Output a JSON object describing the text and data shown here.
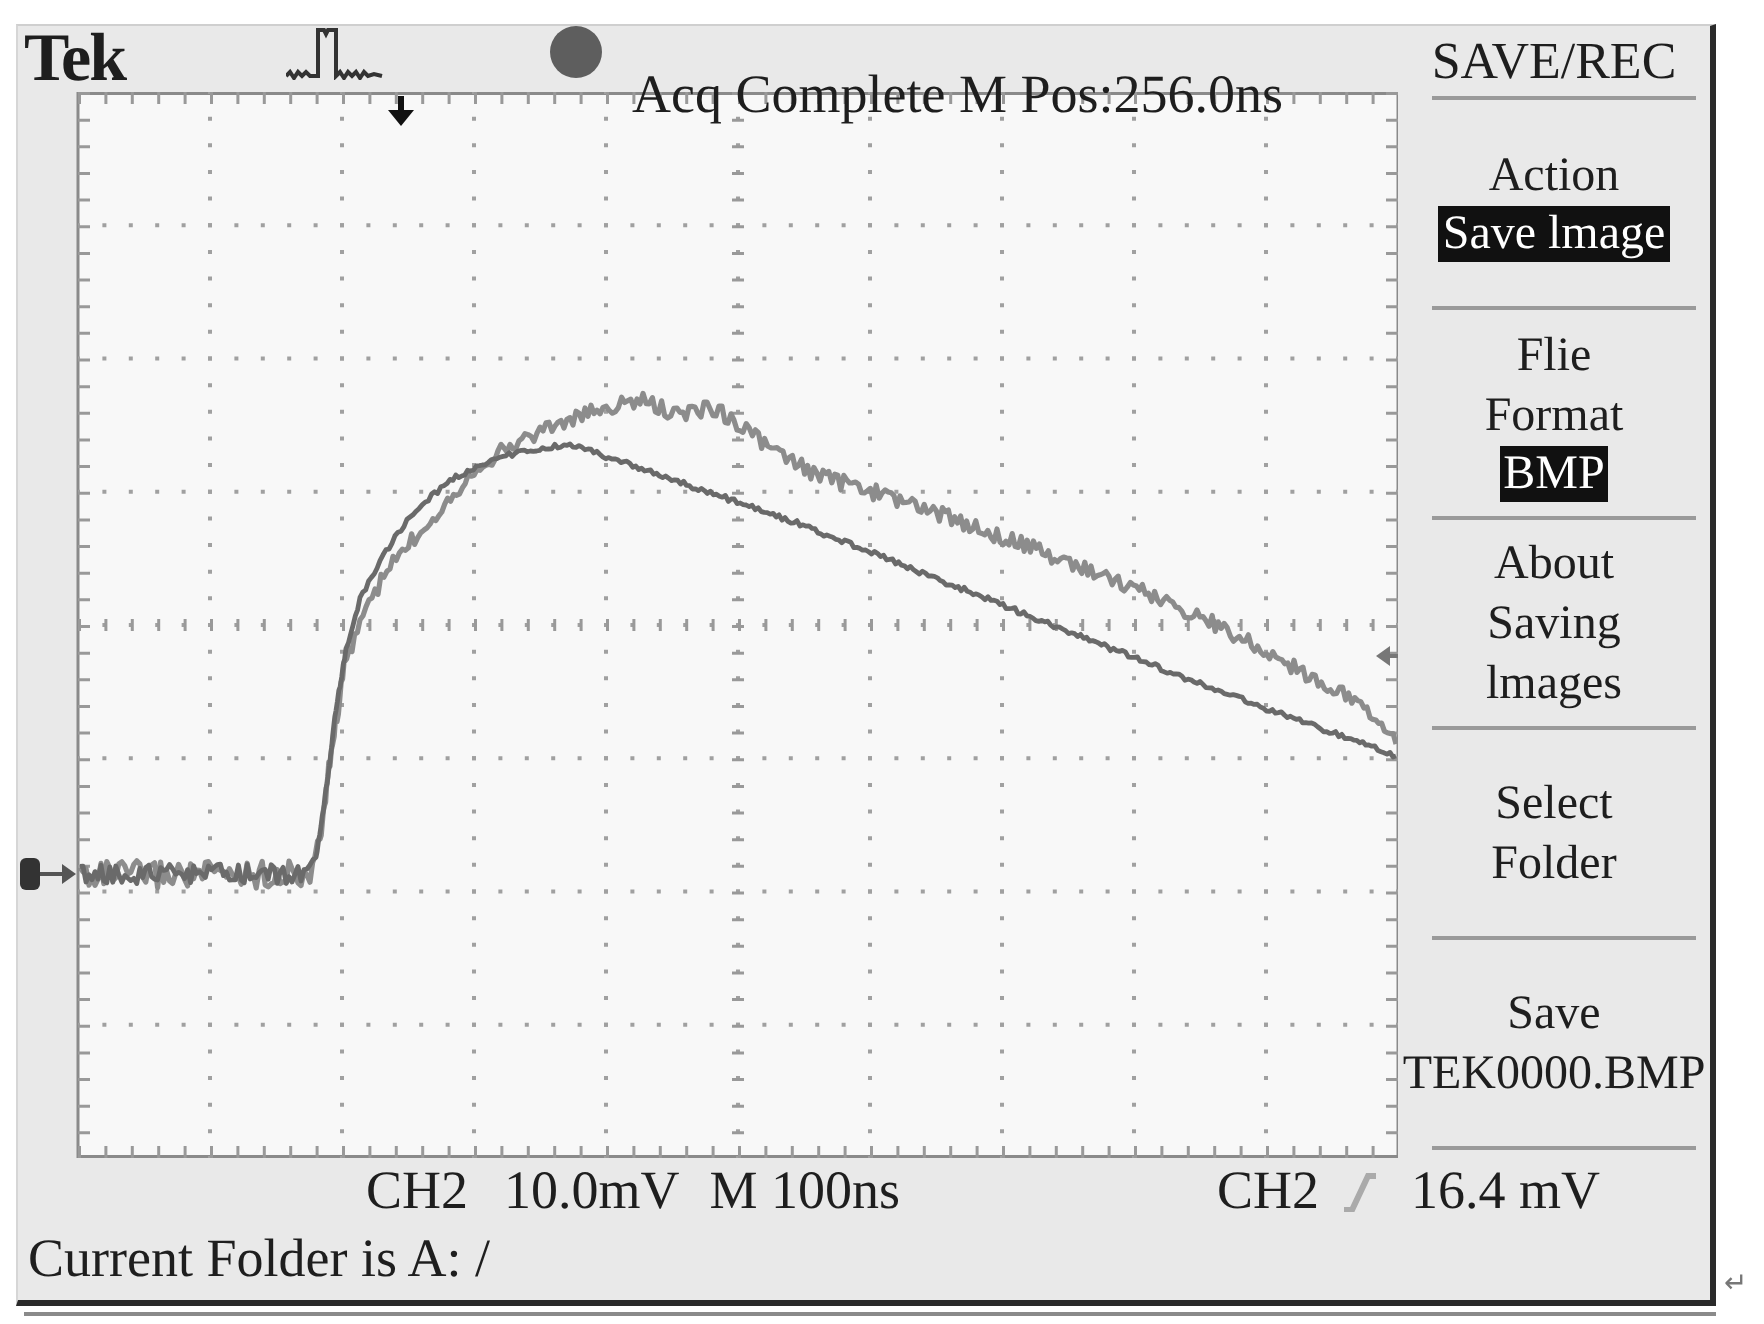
{
  "header": {
    "brand": "Tek",
    "status": "Acq Complete M Pos:256.0ns"
  },
  "menu": {
    "title": "SAVE/REC",
    "sections": [
      {
        "lines": [
          "Action"
        ],
        "value": {
          "text": "Save lmage",
          "highlighted": true
        }
      },
      {
        "lines": [
          "Flie",
          "Format"
        ],
        "value": {
          "text": "BMP",
          "highlighted": true
        }
      },
      {
        "lines": [
          "About",
          "Saving",
          "lmages"
        ]
      },
      {
        "lines": [
          "Select",
          "Folder"
        ]
      },
      {
        "lines": [
          "Save",
          "TEK0000.BMP"
        ]
      }
    ]
  },
  "readouts": {
    "channel": "CH2",
    "volts_per_div": "10.0mV",
    "time_per_div": "M 100ns",
    "trigger_source": "CH2",
    "trigger_level": "16.4 mV"
  },
  "folder_line": "Current Folder is A: /",
  "end_mark": "↵"
}
